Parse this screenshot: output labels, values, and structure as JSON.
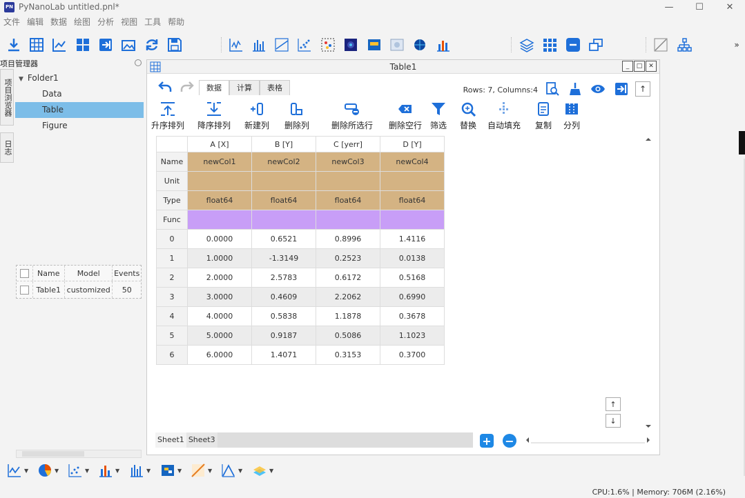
{
  "app": {
    "logo_text": "PN",
    "title": "PyNanoLab    untitled.pnl*"
  },
  "window_controls": {
    "minimize": "—",
    "maximize": "☐",
    "close": "✕"
  },
  "menu": [
    "文件",
    "编辑",
    "数据",
    "绘图",
    "分析",
    "视图",
    "工具",
    "帮助"
  ],
  "toolbar": {
    "icons": [
      "import-icon",
      "grid-icon",
      "chart-eye-icon",
      "plus-grid-icon",
      "export-icon",
      "picture-icon",
      "refresh-icon",
      "save-icon",
      "line-chart-icon",
      "bar-chart-icon",
      "area-chart-icon",
      "scatter-icon",
      "scatter-box-icon",
      "heatmap-icon",
      "image-blue-icon",
      "image-light-icon",
      "mesh-icon",
      "bar-color-icon",
      "layers-icon",
      "dots-grid-icon",
      "minus-square-icon",
      "windows-icon",
      "diagonal-icon",
      "tree-icon"
    ],
    "overflow": "»"
  },
  "left_dock": {
    "tabs": [
      "项目浏览器",
      "日志"
    ],
    "title": "项目管理器",
    "tree": [
      {
        "label": "Folder1",
        "level": 0,
        "expanded": true
      },
      {
        "label": "Data",
        "level": 1
      },
      {
        "label": "Table",
        "level": 1,
        "selected": true
      },
      {
        "label": "Figure",
        "level": 1
      }
    ],
    "props": {
      "headers": [
        "Name",
        "Model",
        "Events"
      ],
      "rows": [
        [
          "Table1",
          "customized",
          "50"
        ]
      ]
    }
  },
  "table_window": {
    "title": "Table1",
    "controls": [
      "_",
      "□",
      "✕"
    ],
    "tabs": [
      "数据",
      "计算",
      "表格"
    ],
    "active_tab": 0,
    "row_count": "Rows: 7, Columns:4",
    "ops": [
      "升序排列",
      "降序排列",
      "新建列",
      "删除列",
      "删除所选行",
      "删除空行",
      "筛选",
      "替换",
      "自动填充",
      "复制",
      "分列"
    ],
    "columns": [
      "A [X]",
      "B [Y]",
      "C [yerr]",
      "D [Y]"
    ],
    "meta": [
      {
        "label": "Name",
        "values": [
          "newCol1",
          "newCol2",
          "newCol3",
          "newCol4"
        ]
      },
      {
        "label": "Unit",
        "values": [
          "",
          "",
          "",
          ""
        ]
      },
      {
        "label": "Type",
        "values": [
          "float64",
          "float64",
          "float64",
          "float64"
        ]
      },
      {
        "label": "Func",
        "values": [
          "",
          "",
          "",
          ""
        ]
      }
    ],
    "rows": [
      {
        "idx": "0",
        "values": [
          "0.0000",
          "0.6521",
          "0.8996",
          "1.4116"
        ]
      },
      {
        "idx": "1",
        "values": [
          "1.0000",
          "-1.3149",
          "0.2523",
          "0.0138"
        ]
      },
      {
        "idx": "2",
        "values": [
          "2.0000",
          "2.5783",
          "0.6172",
          "0.5168"
        ]
      },
      {
        "idx": "3",
        "values": [
          "3.0000",
          "0.4609",
          "2.2062",
          "0.6990"
        ]
      },
      {
        "idx": "4",
        "values": [
          "4.0000",
          "0.5838",
          "1.1878",
          "0.3678"
        ]
      },
      {
        "idx": "5",
        "values": [
          "5.0000",
          "0.9187",
          "0.5086",
          "1.1023"
        ]
      },
      {
        "idx": "6",
        "values": [
          "6.0000",
          "1.4071",
          "0.3153",
          "0.3700"
        ]
      }
    ],
    "sheets": [
      "Sheet1",
      "Sheet3"
    ],
    "arrow_up": "↑",
    "arrow_down": "↓",
    "scroll_up": "↑"
  },
  "bottom_toolbar": [
    "line-chart-icon",
    "pie-chart-icon",
    "scatter-icon",
    "bar-chart-icon",
    "column-chart-icon",
    "heatmap-icon",
    "gradient-icon",
    "peak-icon",
    "3d-icon"
  ],
  "status": "CPU:1.6% | Memory: 706M (2.16%)",
  "colors": {
    "accent": "#1e88e5",
    "meta_row": "#d4b383",
    "func_row": "#c89ef7",
    "selected": "#7cbde8"
  }
}
